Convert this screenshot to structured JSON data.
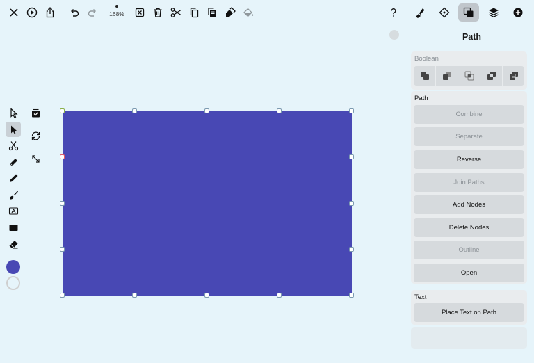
{
  "toolbar": {
    "zoom_label": "168%",
    "icons": [
      "close-icon",
      "play-icon",
      "share-icon",
      "undo-icon",
      "redo-icon",
      "deselect-icon",
      "trash-icon",
      "cut-icon",
      "copy-icon",
      "paste-icon",
      "paste-style-icon",
      "fill-bucket-icon"
    ]
  },
  "right_tabs": {
    "icons": [
      "help-icon",
      "style-icon",
      "nodes-icon",
      "path-ops-icon",
      "layers-icon",
      "add-icon"
    ],
    "active": "path-ops-icon"
  },
  "tools": {
    "items": [
      "select-icon",
      "node-select-icon",
      "scissors-icon",
      "pen-icon",
      "pencil-icon",
      "brush-icon",
      "text-icon",
      "rectangle-icon",
      "eraser-icon"
    ],
    "active": "node-select-icon",
    "secondary": [
      "stack-check-icon",
      "rotate-icon",
      "resize-icon"
    ],
    "fill_color": "#4848b4",
    "stroke_color": "#cfcfcf"
  },
  "canvas": {
    "shape_color": "#4848b4"
  },
  "panel": {
    "title": "Path",
    "boolean": {
      "label": "Boolean",
      "ops": [
        "union-icon",
        "subtract-icon",
        "intersect-icon",
        "exclude-icon",
        "divide-icon"
      ]
    },
    "path": {
      "label": "Path",
      "buttons": [
        {
          "label": "Combine",
          "enabled": false
        },
        {
          "label": "Separate",
          "enabled": false
        },
        {
          "label": "Reverse",
          "enabled": true
        },
        {
          "label": "Join Paths",
          "enabled": false
        },
        {
          "label": "Add Nodes",
          "enabled": true
        },
        {
          "label": "Delete Nodes",
          "enabled": true
        },
        {
          "label": "Outline",
          "enabled": false
        },
        {
          "label": "Open",
          "enabled": true
        }
      ]
    },
    "text": {
      "label": "Text",
      "buttons": [
        {
          "label": "Place Text on Path",
          "enabled": true
        }
      ]
    }
  }
}
